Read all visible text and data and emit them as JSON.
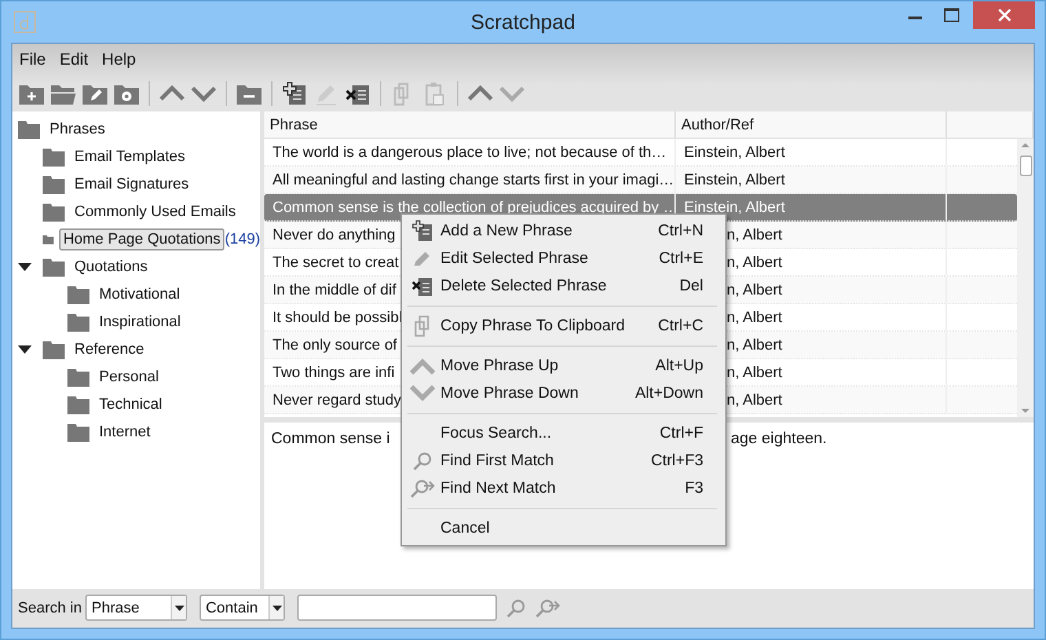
{
  "window": {
    "title": "Scratchpad"
  },
  "menu_bar": [
    "File",
    "Edit",
    "Help"
  ],
  "tree": [
    {
      "label": "Phrases",
      "selected": false,
      "children": [
        {
          "label": "Email Templates",
          "selected": false
        },
        {
          "label": "Email Signatures",
          "selected": false
        },
        {
          "label": "Commonly Used Emails",
          "selected": false
        },
        {
          "label": "Home Page Quotations",
          "count": "(149)",
          "selected": true
        }
      ]
    },
    {
      "label": "Quotations",
      "selected": false,
      "expanded": true,
      "children": [
        {
          "label": "Motivational",
          "selected": false
        },
        {
          "label": "Inspirational",
          "selected": false
        }
      ]
    },
    {
      "label": "Reference",
      "selected": false,
      "expanded": true,
      "children": [
        {
          "label": "Personal",
          "selected": false
        },
        {
          "label": "Technical",
          "selected": false
        },
        {
          "label": "Internet",
          "selected": false
        }
      ]
    }
  ],
  "table": {
    "columns": [
      "Phrase",
      "Author/Ref"
    ],
    "rows": [
      {
        "phrase": "The world is a dangerous place to live; not because of th…",
        "author": "Einstein, Albert",
        "selected": false
      },
      {
        "phrase": "All meaningful and lasting change starts first in your imagi…",
        "author": "Einstein, Albert",
        "selected": false
      },
      {
        "phrase": "Common sense is the collection of prejudices acquired by …",
        "author": "Einstein, Albert",
        "selected": true
      },
      {
        "phrase": "Never do anything",
        "author": "n, Albert",
        "selected": false
      },
      {
        "phrase": "The secret to creat",
        "author": "n, Albert",
        "selected": false
      },
      {
        "phrase": "In the middle of dif",
        "author": "n, Albert",
        "selected": false
      },
      {
        "phrase": "It should be possibl",
        "author": "n, Albert",
        "selected": false
      },
      {
        "phrase": "The only source of",
        "author": "n, Albert",
        "selected": false
      },
      {
        "phrase": "Two things are infi",
        "author": "n, Albert",
        "selected": false
      },
      {
        "phrase": "Never regard study",
        "author": "n, Albert",
        "selected": false
      }
    ]
  },
  "detail": {
    "text_start": "Common sense i",
    "text_end": "age eighteen."
  },
  "context_menu": [
    [
      {
        "label": "Add a New Phrase",
        "shortcut": "Ctrl+N"
      },
      {
        "label": "Edit Selected Phrase",
        "shortcut": "Ctrl+E"
      },
      {
        "label": "Delete Selected Phrase",
        "shortcut": "Del"
      }
    ],
    [
      {
        "label": "Copy Phrase To Clipboard",
        "shortcut": "Ctrl+C"
      }
    ],
    [
      {
        "label": "Move Phrase Up",
        "shortcut": "Alt+Up"
      },
      {
        "label": "Move Phrase Down",
        "shortcut": "Alt+Down"
      }
    ],
    [
      {
        "label": "Focus Search...",
        "shortcut": "Ctrl+F"
      },
      {
        "label": "Find First Match",
        "shortcut": "Ctrl+F3"
      },
      {
        "label": "Find Next Match",
        "shortcut": "F3"
      }
    ],
    [
      {
        "label": "Cancel"
      }
    ]
  ],
  "search_bar": {
    "label": "Search in",
    "field": "Phrase",
    "mode": "Contain"
  }
}
